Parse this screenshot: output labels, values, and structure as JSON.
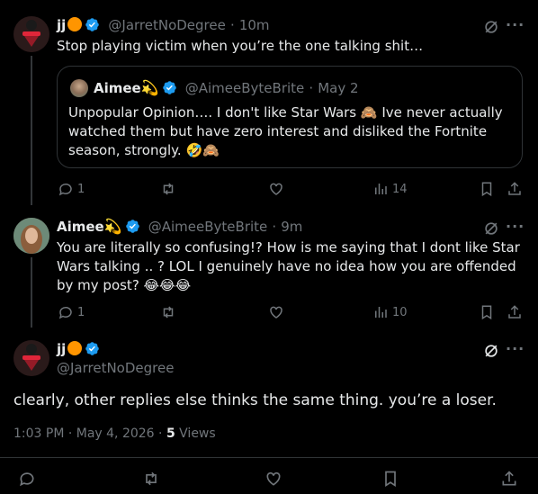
{
  "tweet1": {
    "name": "jj",
    "handle": "@JarretNoDegree",
    "time": "10m",
    "text": "Stop playing victim when you’re the one talking shit…",
    "quote": {
      "name": "Aimee",
      "handle": "@AimeeByteBrite",
      "time": "May 2",
      "text": "Unpopular Opinion…. I don't like Star Wars 🙈  Ive never actually watched them but have zero interest and disliked the Fortnite season, strongly. 🤣🙈"
    },
    "replies": "1",
    "views": "14"
  },
  "tweet2": {
    "name": "Aimee",
    "handle": "@AimeeByteBrite",
    "time": "9m",
    "text": "You are literally so confusing!? How is me saying that I dont like Star Wars talking .. ? LOL  I genuinely have no idea how you are offended by my post? 😂😂😂",
    "replies": "1",
    "views": "10"
  },
  "tweet3": {
    "name": "jj",
    "handle": "@JarretNoDegree",
    "text": "clearly, other replies else thinks the same thing. you’re a loser.",
    "timestamp": "1:03 PM · May 4, 2026 · ",
    "views_count": "5",
    "views_label": " Views"
  },
  "sep": "·",
  "colors": {
    "accent": "#1d9bf0",
    "orange": "#ff9500",
    "muted": "#71767b",
    "text": "#e7e9ea"
  }
}
